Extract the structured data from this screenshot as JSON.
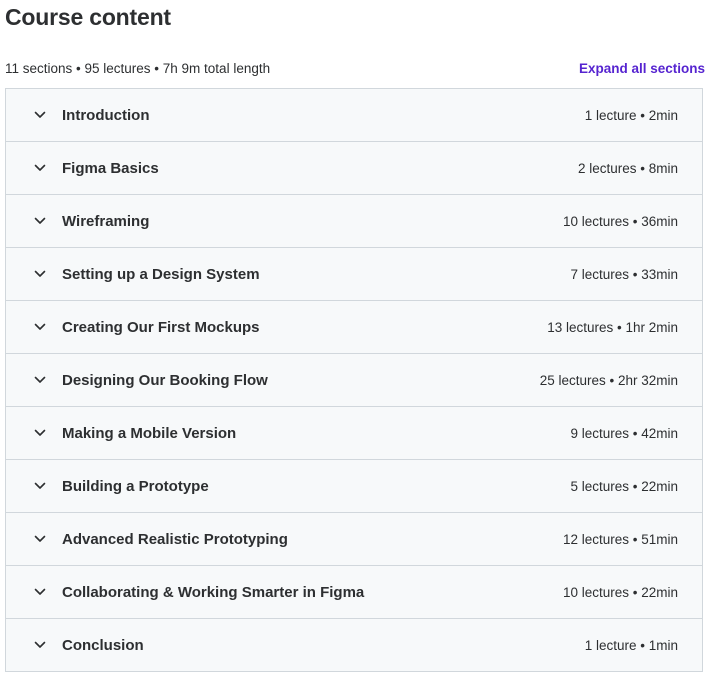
{
  "header": {
    "title": "Course content",
    "summary": "11 sections • 95 lectures • 7h 9m total length",
    "expand_label": "Expand all sections"
  },
  "colors": {
    "accent": "#5624d0",
    "section_bg": "#f7f9fa",
    "border": "#d1d7dc",
    "text": "#2d2f31"
  },
  "sections": [
    {
      "title": "Introduction",
      "meta": "1 lecture • 2min",
      "icon": "chevron-down-icon"
    },
    {
      "title": "Figma Basics",
      "meta": "2 lectures • 8min",
      "icon": "chevron-down-icon"
    },
    {
      "title": "Wireframing",
      "meta": "10 lectures • 36min",
      "icon": "chevron-down-icon"
    },
    {
      "title": "Setting up a Design System",
      "meta": "7 lectures • 33min",
      "icon": "chevron-down-icon"
    },
    {
      "title": "Creating Our First Mockups",
      "meta": "13 lectures • 1hr 2min",
      "icon": "chevron-down-icon"
    },
    {
      "title": "Designing Our Booking Flow",
      "meta": "25 lectures • 2hr 32min",
      "icon": "chevron-down-icon"
    },
    {
      "title": "Making a Mobile Version",
      "meta": "9 lectures • 42min",
      "icon": "chevron-down-icon"
    },
    {
      "title": "Building a Prototype",
      "meta": "5 lectures • 22min",
      "icon": "chevron-down-icon"
    },
    {
      "title": "Advanced Realistic Prototyping",
      "meta": "12 lectures • 51min",
      "icon": "chevron-down-icon"
    },
    {
      "title": "Collaborating & Working Smarter in Figma",
      "meta": "10 lectures • 22min",
      "icon": "chevron-down-icon"
    },
    {
      "title": "Conclusion",
      "meta": "1 lecture • 1min",
      "icon": "chevron-down-icon"
    }
  ]
}
